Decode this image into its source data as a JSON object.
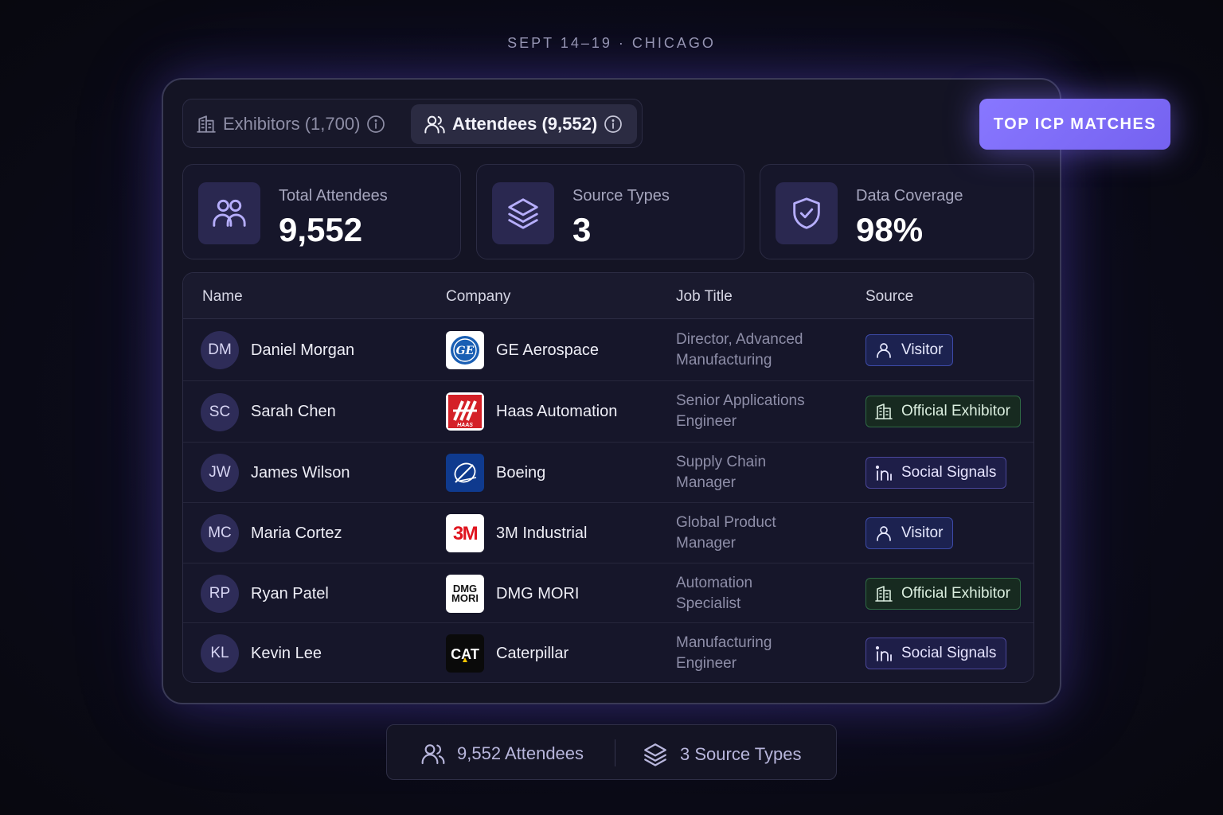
{
  "event": {
    "date_location": "SEPT 14–19 · CHICAGO"
  },
  "tabs": [
    {
      "label": "Exhibitors (1,700)",
      "icon": "building-icon",
      "active": false
    },
    {
      "label": "Attendees (9,552)",
      "icon": "users-icon",
      "active": true
    }
  ],
  "cta": {
    "label": "TOP ICP MATCHES"
  },
  "stats": [
    {
      "label": "Total Attendees",
      "value": "9,552",
      "icon": "users-icon"
    },
    {
      "label": "Source Types",
      "value": "3",
      "icon": "layers-icon"
    },
    {
      "label": "Data Coverage",
      "value": "98%",
      "icon": "shield-check-icon"
    }
  ],
  "table": {
    "headers": {
      "name": "Name",
      "company": "Company",
      "job_title": "Job Title",
      "source": "Source"
    },
    "rows": [
      {
        "initials": "DM",
        "name": "Daniel Morgan",
        "company": "GE Aerospace",
        "logo": "ge-logo",
        "job_line1": "Director, Advanced",
        "job_line2": "Manufacturing",
        "source": "Visitor",
        "source_type": "visitor"
      },
      {
        "initials": "SC",
        "name": "Sarah Chen",
        "company": "Haas Automation",
        "logo": "haas-logo",
        "job_line1": "Senior Applications",
        "job_line2": "Engineer",
        "source": "Official Exhibitor",
        "source_type": "exhibitor"
      },
      {
        "initials": "JW",
        "name": "James Wilson",
        "company": "Boeing",
        "logo": "boeing-logo",
        "job_line1": "Supply Chain",
        "job_line2": "Manager",
        "source": "Social Signals",
        "source_type": "social"
      },
      {
        "initials": "MC",
        "name": "Maria Cortez",
        "company": "3M Industrial",
        "logo": "3m-logo",
        "job_line1": "Global Product",
        "job_line2": "Manager",
        "source": "Visitor",
        "source_type": "visitor"
      },
      {
        "initials": "RP",
        "name": "Ryan Patel",
        "company": "DMG MORI",
        "logo": "dmg-mori-logo",
        "job_line1": "Automation",
        "job_line2": "Specialist",
        "source": "Official Exhibitor",
        "source_type": "exhibitor"
      },
      {
        "initials": "KL",
        "name": "Kevin Lee",
        "company": "Caterpillar",
        "logo": "cat-logo",
        "job_line1": "Manufacturing",
        "job_line2": "Engineer",
        "source": "Social Signals",
        "source_type": "social"
      }
    ]
  },
  "logo_text": {
    "haas": "HAAS",
    "three_m": "3M",
    "dmg_line1": "DMG",
    "dmg_line2": "MORI",
    "cat": "CAT"
  },
  "summary": {
    "attendees": "9,552 Attendees",
    "source_types": "3 Source Types"
  },
  "colors": {
    "accent": "#7f6ef8",
    "visitor": "#3d4aa8",
    "exhibitor": "#2f6a44",
    "social": "#4a469a"
  }
}
